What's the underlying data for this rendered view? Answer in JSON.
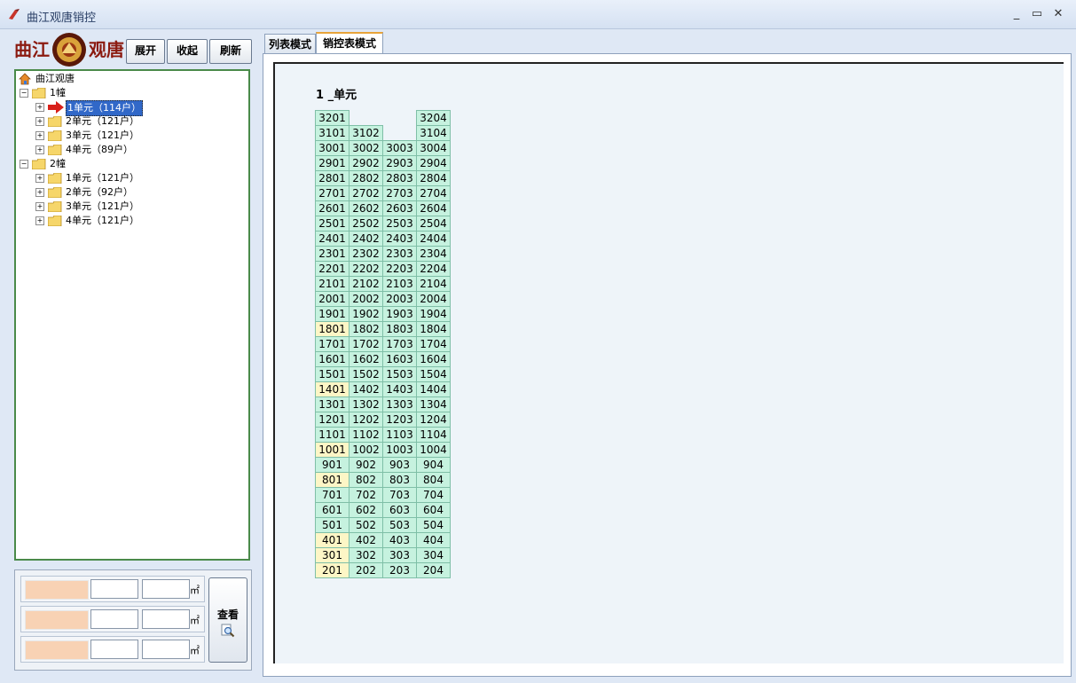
{
  "window": {
    "title": "曲江观唐销控"
  },
  "logo": {
    "text_left": "曲江",
    "text_right": "观唐"
  },
  "toolbar": {
    "expand": "展开",
    "collapse": "收起",
    "refresh": "刷新"
  },
  "tree": {
    "root": "曲江观唐",
    "buildings": [
      {
        "label": "1幢",
        "units": [
          {
            "label": "1单元（114户）",
            "selected": true
          },
          {
            "label": "2单元（121户）"
          },
          {
            "label": "3单元（121户）"
          },
          {
            "label": "4单元（89户）"
          }
        ]
      },
      {
        "label": "2幢",
        "units": [
          {
            "label": "1单元（121户）"
          },
          {
            "label": "2单元（92户）"
          },
          {
            "label": "3单元（121户）"
          },
          {
            "label": "4单元（121户）"
          }
        ]
      }
    ]
  },
  "filter": {
    "unit_symbol": "㎡",
    "view_button": "查看"
  },
  "tabs": [
    {
      "label": "列表模式",
      "active": false
    },
    {
      "label": "销控表模式",
      "active": true
    }
  ],
  "sales_table": {
    "unit_title": "1 _单元",
    "rows": [
      [
        "3201",
        "",
        "",
        "3204"
      ],
      [
        "3101",
        "3102",
        "",
        "3104"
      ],
      [
        "3001",
        "3002",
        "3003",
        "3004"
      ],
      [
        "2901",
        "2902",
        "2903",
        "2904"
      ],
      [
        "2801",
        "2802",
        "2803",
        "2804"
      ],
      [
        "2701",
        "2702",
        "2703",
        "2704"
      ],
      [
        "2601",
        "2602",
        "2603",
        "2604"
      ],
      [
        "2501",
        "2502",
        "2503",
        "2504"
      ],
      [
        "2401",
        "2402",
        "2403",
        "2404"
      ],
      [
        "2301",
        "2302",
        "2303",
        "2304"
      ],
      [
        "2201",
        "2202",
        "2203",
        "2204"
      ],
      [
        "2101",
        "2102",
        "2103",
        "2104"
      ],
      [
        "2001",
        "2002",
        "2003",
        "2004"
      ],
      [
        "1901",
        "1902",
        "1903",
        "1904"
      ],
      [
        "1801",
        "1802",
        "1803",
        "1804"
      ],
      [
        "1701",
        "1702",
        "1703",
        "1704"
      ],
      [
        "1601",
        "1602",
        "1603",
        "1604"
      ],
      [
        "1501",
        "1502",
        "1503",
        "1504"
      ],
      [
        "1401",
        "1402",
        "1403",
        "1404"
      ],
      [
        "1301",
        "1302",
        "1303",
        "1304"
      ],
      [
        "1201",
        "1202",
        "1203",
        "1204"
      ],
      [
        "1101",
        "1102",
        "1103",
        "1104"
      ],
      [
        "1001",
        "1002",
        "1003",
        "1004"
      ],
      [
        "901",
        "902",
        "903",
        "904"
      ],
      [
        "801",
        "802",
        "803",
        "804"
      ],
      [
        "701",
        "702",
        "703",
        "704"
      ],
      [
        "601",
        "602",
        "603",
        "604"
      ],
      [
        "501",
        "502",
        "503",
        "504"
      ],
      [
        "401",
        "402",
        "403",
        "404"
      ],
      [
        "301",
        "302",
        "303",
        "304"
      ],
      [
        "201",
        "202",
        "203",
        "204"
      ]
    ],
    "highlighted_rooms": [
      "1801",
      "1401",
      "1001",
      "801",
      "401",
      "301",
      "201"
    ],
    "colors": {
      "available": "#c6f2df",
      "highlighted": "#fdf6c6"
    }
  }
}
